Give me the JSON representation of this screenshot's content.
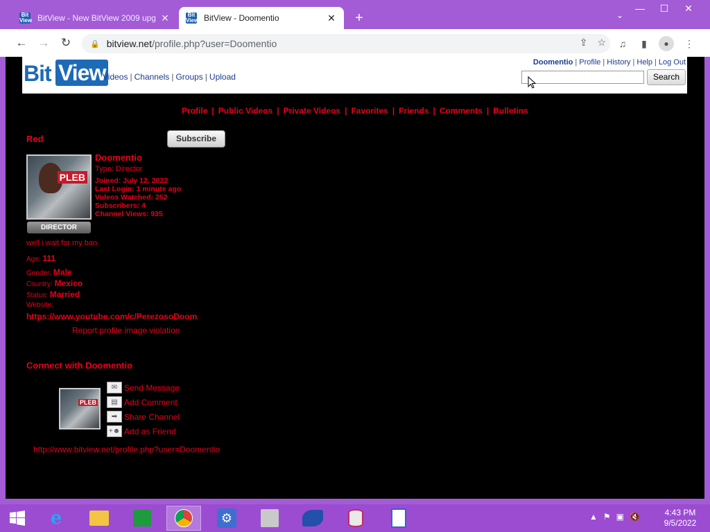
{
  "browser": {
    "tabs": [
      {
        "title": "BitView - New BitView 2009 upg",
        "active": false
      },
      {
        "title": "BitView - Doomentio",
        "active": true
      }
    ],
    "favicon_top": "Bit",
    "favicon_bottom": "View",
    "new_tab_label": "+",
    "url_host": "bitview.net",
    "url_path": "/profile.php?user=Doomentio"
  },
  "site": {
    "logo_bit": "Bit",
    "logo_view": "View",
    "nav": [
      "Videos",
      "Channels",
      "Groups",
      "Upload"
    ],
    "user_links": [
      "Doomentio",
      "Profile",
      "History",
      "Help",
      "Log Out"
    ],
    "search_button": "Search",
    "search_value": ""
  },
  "profile_nav": [
    "Profile",
    "Public Videos",
    "Private Videos",
    "Favorites",
    "Friends",
    "Comments",
    "Bulletins"
  ],
  "profile": {
    "display_name": "Red",
    "subscribe_label": "Subscribe",
    "avatar_text": "PLEB",
    "badge": "DIRECTOR",
    "username": "Doomentio",
    "type_label": "Type:",
    "type_value": "Director",
    "joined": "Joined: July 12, 2022",
    "last_login": "Last Login: 1 minute ago",
    "videos_watched": "Videos Watched: 252",
    "subscribers": "Subscribers: 4",
    "channel_views": "Channel Views: 935",
    "bio": "well i wait for my ban",
    "age_label": "Age:",
    "age_value": "111",
    "gender_label": "Gender:",
    "gender_value": "Male",
    "country_label": "Country:",
    "country_value": "Mexico",
    "status_label": "Status:",
    "status_value": "Married",
    "website_label": "Website:",
    "website_value": "https://www.youtube.com/c/PerezosoDoom",
    "report": "Report profile image violation"
  },
  "connect": {
    "title": "Connect with Doomentio",
    "actions": [
      "Send Message",
      "Add Comment",
      "Share Channel",
      "Add as Friend"
    ],
    "profile_url": "http://www.bitview.net/profile.php?user=Doomentio"
  },
  "taskbar": {
    "time": "4:43 PM",
    "date": "9/5/2022"
  },
  "colors": {
    "accent_red": "#e8001c",
    "link_blue": "#1a3c8c",
    "chrome_purple": "#a35bd6"
  }
}
